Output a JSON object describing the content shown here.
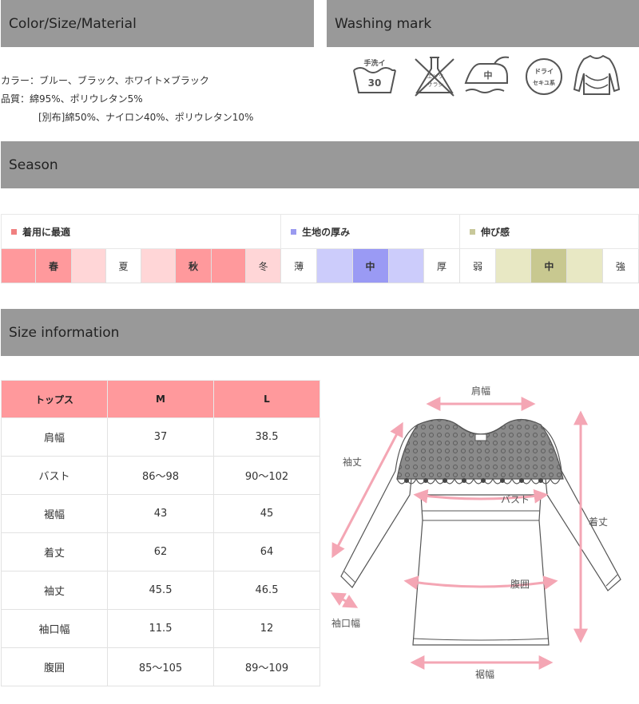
{
  "sections": {
    "color_size_material": "Color/Size/Material",
    "washing_mark": "Washing mark",
    "season": "Season",
    "size_information": "Size information"
  },
  "material": {
    "color_line": "カラー：ブルー、ブラック、ホワイト×ブラック",
    "quality_line": "品質：綿95%、ポリウレタン5%",
    "separate_line": "[別布]綿50%、ナイロン40%、ポリウレタン10%"
  },
  "washing_icons": [
    {
      "name": "hand-wash-30-icon",
      "top_text": "手洗イ",
      "number": "30"
    },
    {
      "name": "no-chlorine-bleach-icon",
      "text_1": "エンソ",
      "text_2": "サラシ"
    },
    {
      "name": "iron-medium-icon",
      "text": "中"
    },
    {
      "name": "dry-clean-petroleum-icon",
      "text_1": "ドライ",
      "text_2": "セキユ系"
    },
    {
      "name": "flat-dry-sweater-icon"
    }
  ],
  "season_table": {
    "headers": [
      {
        "label": "着用に最適",
        "color": "#f08080"
      },
      {
        "label": "生地の厚み",
        "color": "#9a9af0"
      },
      {
        "label": "伸び感",
        "color": "#c8c89a"
      }
    ],
    "seasons": [
      "春",
      "夏",
      "秋",
      "冬"
    ],
    "thickness": [
      "薄",
      "中",
      "厚"
    ],
    "stretch": [
      "弱",
      "中",
      "強"
    ]
  },
  "size_table": {
    "headers": [
      "トップス",
      "M",
      "L"
    ],
    "rows": [
      [
        "肩幅",
        "37",
        "38.5"
      ],
      [
        "バスト",
        "86～98",
        "90～102"
      ],
      [
        "裾幅",
        "43",
        "45"
      ],
      [
        "着丈",
        "62",
        "64"
      ],
      [
        "袖丈",
        "45.5",
        "46.5"
      ],
      [
        "袖口幅",
        "11.5",
        "12"
      ],
      [
        "腹囲",
        "85～105",
        "89～109"
      ]
    ]
  },
  "diagram_labels": {
    "shoulder": "肩幅",
    "sleeve": "袖丈",
    "bust": "バスト",
    "length": "着丈",
    "waist": "腹囲",
    "cuff": "袖口幅",
    "hem": "裾幅"
  },
  "colors": {
    "header_bar": "#999999",
    "accent_pink": "#ff999c",
    "season_dark": "#ff999c",
    "season_light": "#ffd6d7",
    "thickness_dark": "#9a9af4",
    "thickness_light": "#ccccfb",
    "stretch_dark": "#c8c890",
    "stretch_light": "#e8e8c4",
    "measure_arrow": "#f4a6b4"
  }
}
